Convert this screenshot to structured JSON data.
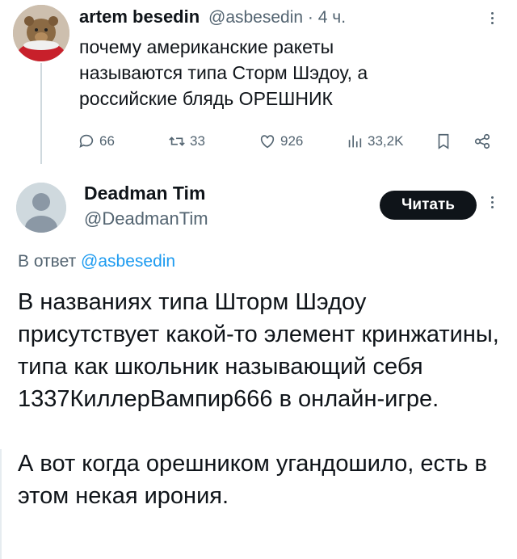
{
  "tweet1": {
    "name": "artem besedin",
    "handle": "@asbesedin",
    "time": "· 4 ч.",
    "text": "почему американские ракеты называются типа Сторм Шэдоу, а российские блядь ОРЕШНИК",
    "stats": {
      "replies": "66",
      "retweets": "33",
      "likes": "926",
      "views": "33,2K"
    }
  },
  "tweet2": {
    "name": "Deadman Tim",
    "handle": "@DeadmanTim",
    "follow_label": "Читать",
    "reply_prefix": "В ответ",
    "reply_mention": "@asbesedin",
    "paragraph1": "В названиях типа Шторм Шэдоу присутствует какой-то элемент кринжатины, типа как школьник называющий себя 1337КиллерВампир666 в онлайн-игре.",
    "paragraph2": "А вот когда орешником угандошило, есть в этом некая ирония."
  },
  "icons": {
    "reply": "reply-icon",
    "retweet": "retweet-icon",
    "like": "heart-icon",
    "views": "views-icon",
    "bookmark": "bookmark-icon",
    "share": "share-icon",
    "more": "more-icon",
    "avatar_default": "default-avatar-icon"
  },
  "colors": {
    "text": "#0f1419",
    "muted": "#536471",
    "link": "#1d9bf0",
    "button": "#0f1419"
  }
}
